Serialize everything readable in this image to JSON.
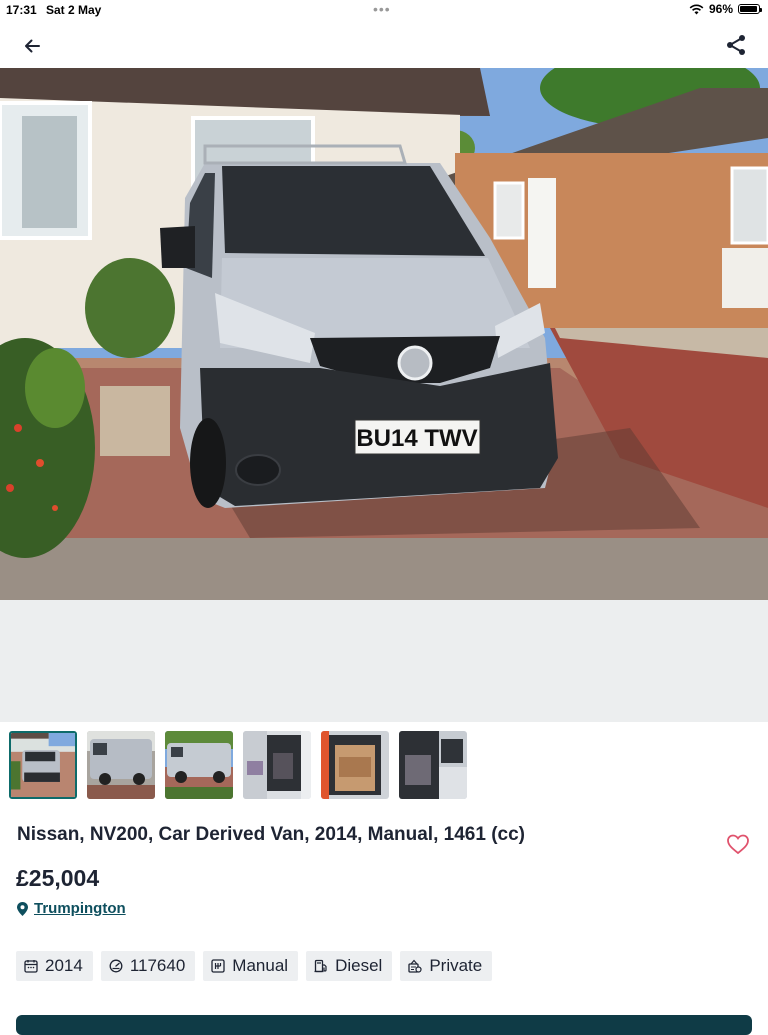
{
  "status_bar": {
    "time": "17:31",
    "date": "Sat 2 May",
    "battery": "96%",
    "battery_level": 0.96
  },
  "nav": {
    "back_icon": "arrow-left-icon",
    "share_icon": "share-icon"
  },
  "hero": {
    "plate_text": "BU14 TWV"
  },
  "thumbnails": [
    {
      "label": "thumb-1",
      "active": true
    },
    {
      "label": "thumb-2",
      "active": false
    },
    {
      "label": "thumb-3",
      "active": false
    },
    {
      "label": "thumb-4",
      "active": false
    },
    {
      "label": "thumb-5",
      "active": false
    },
    {
      "label": "thumb-6",
      "active": false
    }
  ],
  "listing": {
    "title": "Nissan, NV200, Car Derived Van, 2014, Manual, 1461 (cc)",
    "price": "£25,004",
    "location": "Trumpington",
    "favourite_icon": "heart-icon"
  },
  "specs": [
    {
      "icon": "calendar-icon",
      "value": "2014"
    },
    {
      "icon": "speedometer-icon",
      "value": "117640"
    },
    {
      "icon": "gearbox-icon",
      "value": "Manual"
    },
    {
      "icon": "fuel-pump-icon",
      "value": "Diesel"
    },
    {
      "icon": "seller-icon",
      "value": "Private"
    }
  ],
  "colors": {
    "accent": "#0d6b6a",
    "link": "#0e4f5e",
    "heart": "#e0536d",
    "bottom_bar": "#0f3b46"
  }
}
